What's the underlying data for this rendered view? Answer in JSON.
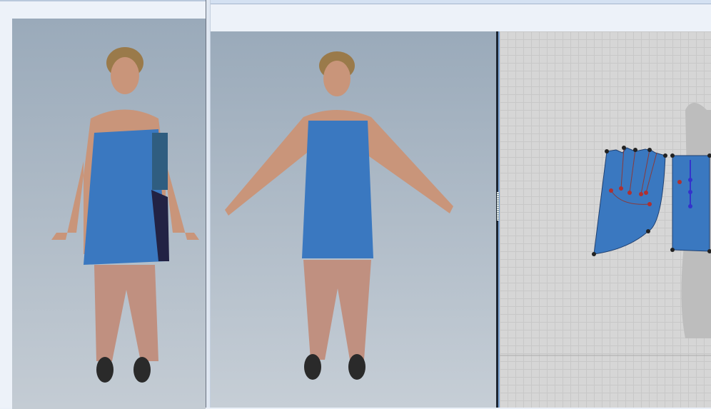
{
  "colors": {
    "garment": "#3a78c0",
    "viewport_bg": "#9aaaba",
    "pattern_grid": "#d6d6d6",
    "point_black": "#222222",
    "point_red": "#b03030",
    "point_blue": "#3333cc"
  }
}
